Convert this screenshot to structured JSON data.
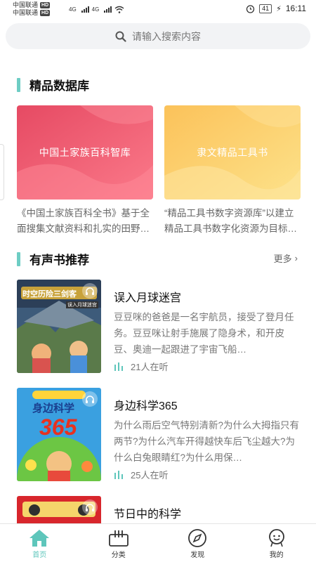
{
  "status_bar": {
    "carrier1": "中国联通",
    "carrier2": "中国联通",
    "hd_badge": "HD",
    "network": "4G",
    "battery": "41",
    "time": "16:11"
  },
  "search": {
    "placeholder": "请输入搜索内容"
  },
  "database_section": {
    "title": "精品数据库",
    "cards": [
      {
        "title": "中国土家族百科智库",
        "description": "《中国土家族百科全书》基于全面搜集文献资料和扎实的田野调查，系统地介绍了土家族的历史与文化"
      },
      {
        "title": "隶文精品工具书",
        "description": "“精品工具书数字资源库”以建立精品工具书数字化资源为目标，集成多种权威工具书"
      }
    ]
  },
  "audiobook_section": {
    "title": "有声书推荐",
    "more_label": "更多",
    "books": [
      {
        "title": "误入月球迷宫",
        "cover_text": "时空历险三剑客",
        "cover_sub": "误入月球迷宫",
        "description": "豆豆咪的爸爸是一名宇航员，接受了登月任务。豆豆咪让射手施展了隐身术，和开皮豆、奥迪一起跟进了宇宙飞船…",
        "listeners": "21人在听"
      },
      {
        "title": "身边科学365",
        "cover_text": "身边科学",
        "cover_sub": "365",
        "description": "为什么雨后空气特别清新?为什么大拇指只有两节?为什么汽车开得越快车后飞尘越大?为什么白兔眼睛红?为什么用保…",
        "listeners": "25人在听"
      },
      {
        "title": "节日中的科学",
        "cover_text": "",
        "cover_sub": "",
        "description": "",
        "listeners": ""
      }
    ]
  },
  "tab_bar": {
    "items": [
      {
        "label": "首页",
        "icon": "home-icon",
        "active": true
      },
      {
        "label": "分类",
        "icon": "category-icon",
        "active": false
      },
      {
        "label": "发现",
        "icon": "compass-icon",
        "active": false
      },
      {
        "label": "我的",
        "icon": "profile-icon",
        "active": false
      }
    ]
  },
  "colors": {
    "accent": "#5ec6bb",
    "card_red": "#f0566b",
    "card_yellow": "#fbc45e"
  }
}
